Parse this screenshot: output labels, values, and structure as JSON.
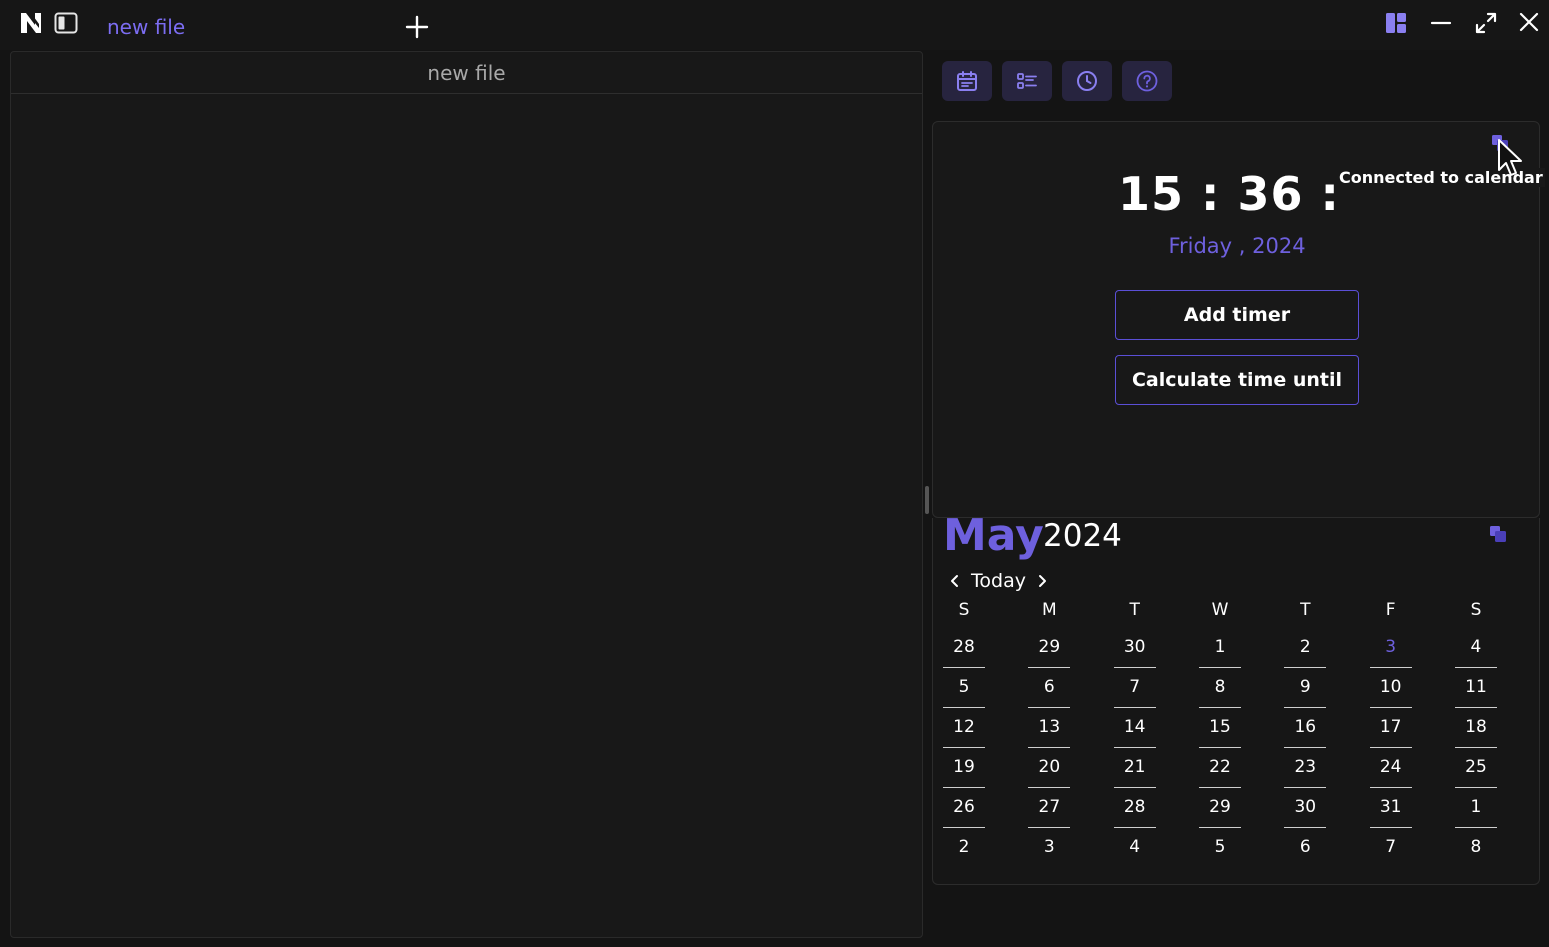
{
  "titlebar": {
    "tab_title": "new file"
  },
  "editor": {
    "header_title": "new file"
  },
  "toolbar": {
    "buttons": [
      "calendar-icon",
      "checklist-icon",
      "clock-icon",
      "help-icon"
    ]
  },
  "clock": {
    "time": "15 : 36 : 07",
    "date": "Friday , 2024",
    "add_timer_label": "Add timer",
    "calculate_label": "Calculate time until",
    "tooltip": "Connected to calendar"
  },
  "calendar": {
    "month": "May",
    "year": "2024",
    "today_label": "Today",
    "weekdays": [
      "S",
      "M",
      "T",
      "W",
      "T",
      "F",
      "S"
    ],
    "weeks": [
      [
        "28",
        "29",
        "30",
        "1",
        "2",
        "3",
        "4"
      ],
      [
        "5",
        "6",
        "7",
        "8",
        "9",
        "10",
        "11"
      ],
      [
        "12",
        "13",
        "14",
        "15",
        "16",
        "17",
        "18"
      ],
      [
        "19",
        "20",
        "21",
        "22",
        "23",
        "24",
        "25"
      ],
      [
        "26",
        "27",
        "28",
        "29",
        "30",
        "31",
        "1"
      ],
      [
        "2",
        "3",
        "4",
        "5",
        "6",
        "7",
        "8"
      ]
    ],
    "today_date": "3"
  },
  "colors": {
    "accent": "#6e60de",
    "background": "#141414",
    "panel": "#181818"
  }
}
